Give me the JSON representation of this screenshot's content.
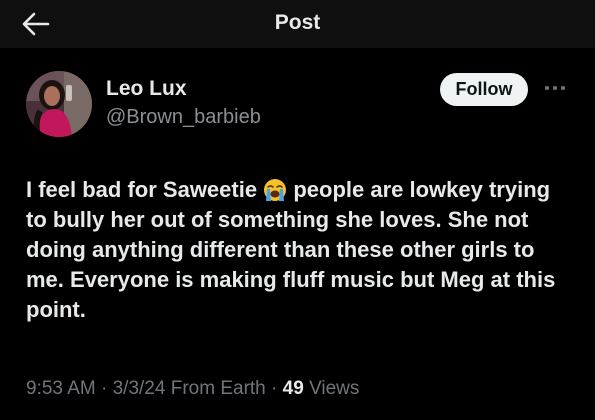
{
  "header": {
    "title": "Post",
    "back_icon": "arrow-left-icon"
  },
  "author": {
    "display_name": "Leo Lux",
    "handle": "@Brown_barbieb",
    "follow_label": "Follow",
    "more_icon": "more-horizontal-icon"
  },
  "tweet": {
    "text_before_emoji": "I feel bad for Saweetie",
    "emoji_icon": "loudly-crying-face-icon",
    "text_after_emoji": "people are lowkey trying to bully her out of something she loves. She not doing anything different than these other girls to me. Everyone is making fluff music but Meg at this point."
  },
  "meta": {
    "time": "9:53 AM",
    "date": "3/3/24",
    "source": "From Earth",
    "views_count": "49",
    "views_label": "Views",
    "separator": "·"
  },
  "colors": {
    "background": "#000000",
    "header_background": "#0f0f0f",
    "text_primary": "#e7e9ea",
    "text_secondary": "#71767b",
    "follow_button_bg": "#eff3f4"
  }
}
